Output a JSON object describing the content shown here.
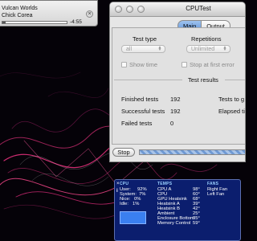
{
  "itunes": {
    "track": "Vulcan Worlds",
    "artist": "Chick Corea",
    "time": "-4:55",
    "progress_fraction": 0.05,
    "close_symbol": "×"
  },
  "cputest": {
    "title": "CPUTest",
    "tabs": [
      {
        "label": "Main",
        "active": true
      },
      {
        "label": "Output",
        "active": false
      }
    ],
    "test_type_label": "Test type",
    "test_type_value": "all",
    "repetitions_label": "Repetitions",
    "repetitions_value": "Unlimited",
    "show_time_label": "Show time",
    "stop_at_first_error_label": "Stop at first error",
    "results_heading": "Test results",
    "finished_label": "Finished tests",
    "finished_value": "192",
    "successful_label": "Successful tests",
    "successful_value": "192",
    "failed_label": "Failed tests",
    "failed_value": "0",
    "tests_to_go_label": "Tests to g",
    "elapsed_label": "Elapsed ti",
    "stop_button": "Stop"
  },
  "monitor": {
    "close_symbol": "×",
    "info_symbol": "i",
    "cpu_header": "CPU",
    "temps_header": "TEMPS",
    "fans_header": "FANS",
    "cpu_stats": [
      {
        "label": "User:",
        "value": "92%"
      },
      {
        "label": "System:",
        "value": "7%"
      },
      {
        "label": "Nice:",
        "value": "0%"
      },
      {
        "label": "Idle:",
        "value": "1%"
      }
    ],
    "temps": [
      {
        "label": "CPU A",
        "value": "98°"
      },
      {
        "label": "CPU",
        "value": "60°"
      },
      {
        "label": "GPU Heatsink",
        "value": "68°"
      },
      {
        "label": "Heatsink A",
        "value": "39°"
      },
      {
        "label": "Heatsink B",
        "value": "42°"
      },
      {
        "label": "Ambient",
        "value": "25°"
      },
      {
        "label": "Enclosure Bottom",
        "value": "35°"
      },
      {
        "label": "Memory Control",
        "value": "59°"
      }
    ],
    "fans": [
      {
        "label": "Right Fan"
      },
      {
        "label": "Left Fan"
      }
    ]
  },
  "colors": {
    "monitor_bg": "#0b1e6e",
    "accent_blue": "#5f93d8",
    "desktop_bg": "#050208",
    "swirl_pink": "#e0307a"
  }
}
